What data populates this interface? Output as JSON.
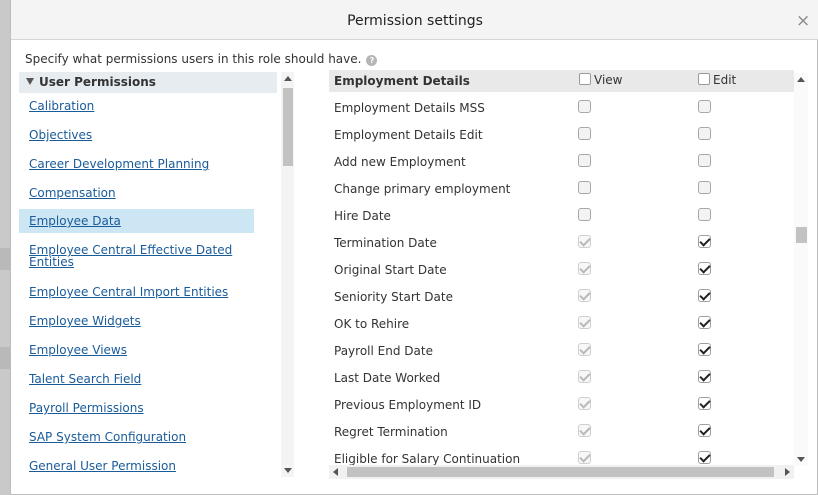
{
  "dialog": {
    "title": "Permission settings",
    "instruction": "Specify what permissions users in this role should have.",
    "close_icon": "close-icon",
    "help_icon": "help-icon"
  },
  "left": {
    "header": "User Permissions",
    "items": [
      {
        "label": "Calibration",
        "selected": false
      },
      {
        "label": "Objectives",
        "selected": false
      },
      {
        "label": "Career Development Planning",
        "selected": false
      },
      {
        "label": "Compensation",
        "selected": false
      },
      {
        "label": "Employee Data",
        "selected": true
      },
      {
        "label": "Employee Central Effective Dated Entities",
        "selected": false
      },
      {
        "label": "Employee Central Import Entities",
        "selected": false
      },
      {
        "label": "Employee Widgets",
        "selected": false
      },
      {
        "label": "Employee Views",
        "selected": false
      },
      {
        "label": "Talent Search Field",
        "selected": false
      },
      {
        "label": "Payroll Permissions",
        "selected": false
      },
      {
        "label": "SAP System Configuration",
        "selected": false
      },
      {
        "label": "General User Permission",
        "selected": false
      }
    ]
  },
  "right": {
    "header": {
      "title": "Employment Details",
      "view": "View",
      "edit": "Edit"
    },
    "rows": [
      {
        "label": "Employment Details MSS",
        "view": false,
        "edit": false,
        "view_disabled": false
      },
      {
        "label": "Employment Details Edit",
        "view": false,
        "edit": false,
        "view_disabled": false
      },
      {
        "label": "Add new Employment",
        "view": false,
        "edit": false,
        "view_disabled": false
      },
      {
        "label": "Change primary employment",
        "view": false,
        "edit": false,
        "view_disabled": false
      },
      {
        "label": "Hire Date",
        "view": false,
        "edit": false,
        "view_disabled": false
      },
      {
        "label": "Termination Date",
        "view": true,
        "edit": true,
        "view_disabled": true
      },
      {
        "label": "Original Start Date",
        "view": true,
        "edit": true,
        "view_disabled": true
      },
      {
        "label": "Seniority Start Date",
        "view": true,
        "edit": true,
        "view_disabled": true
      },
      {
        "label": "OK to Rehire",
        "view": true,
        "edit": true,
        "view_disabled": true
      },
      {
        "label": "Payroll End Date",
        "view": true,
        "edit": true,
        "view_disabled": true
      },
      {
        "label": "Last Date Worked",
        "view": true,
        "edit": true,
        "view_disabled": true
      },
      {
        "label": "Previous Employment ID",
        "view": true,
        "edit": true,
        "view_disabled": true
      },
      {
        "label": "Regret Termination",
        "view": true,
        "edit": true,
        "view_disabled": true
      },
      {
        "label": "Eligible for Salary Continuation",
        "view": true,
        "edit": true,
        "view_disabled": true
      }
    ]
  }
}
